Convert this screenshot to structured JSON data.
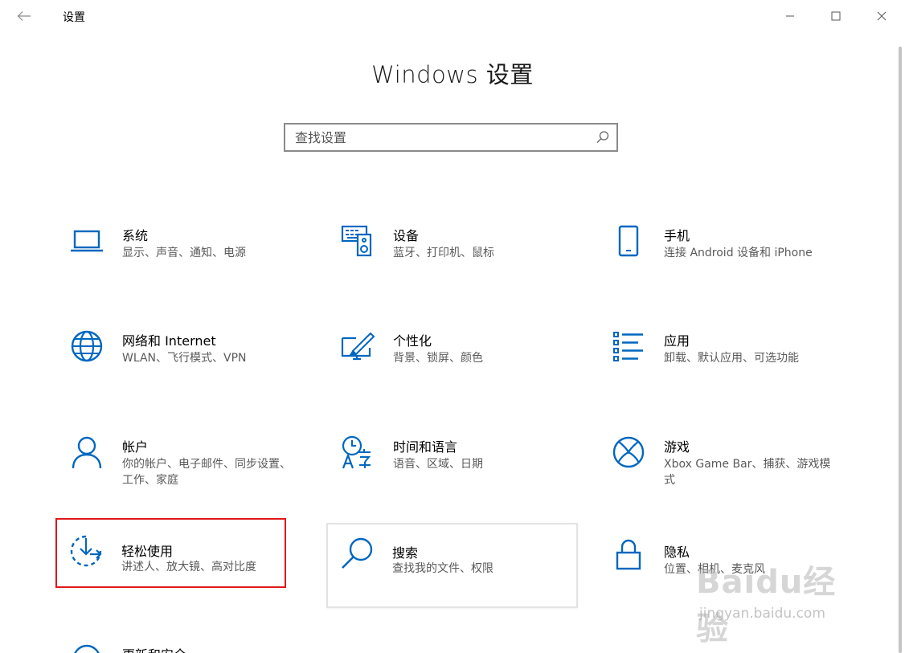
{
  "window": {
    "title": "设置"
  },
  "header": {
    "title": "Windows 设置"
  },
  "search": {
    "placeholder": "查找设置"
  },
  "tiles": [
    {
      "title": "系统",
      "desc": "显示、声音、通知、电源",
      "icon": "laptop-icon"
    },
    {
      "title": "设备",
      "desc": "蓝牙、打印机、鼠标",
      "icon": "devices-icon"
    },
    {
      "title": "手机",
      "desc": "连接 Android 设备和 iPhone",
      "icon": "phone-icon"
    },
    {
      "title": "网络和 Internet",
      "desc": "WLAN、飞行模式、VPN",
      "icon": "globe-icon"
    },
    {
      "title": "个性化",
      "desc": "背景、锁屏、颜色",
      "icon": "personalization-icon"
    },
    {
      "title": "应用",
      "desc": "卸载、默认应用、可选功能",
      "icon": "apps-list-icon"
    },
    {
      "title": "帐户",
      "desc": "你的帐户、电子邮件、同步设置、工作、家庭",
      "icon": "person-icon"
    },
    {
      "title": "时间和语言",
      "desc": "语音、区域、日期",
      "icon": "time-language-icon"
    },
    {
      "title": "游戏",
      "desc": "Xbox Game Bar、捕获、游戏模式",
      "icon": "xbox-icon"
    },
    {
      "title": "轻松使用",
      "desc": "讲述人、放大镜、高对比度",
      "icon": "ease-of-access-icon"
    },
    {
      "title": "搜索",
      "desc": "查找我的文件、权限",
      "icon": "search-magnifier-icon"
    },
    {
      "title": "隐私",
      "desc": "位置、相机、麦克风",
      "icon": "lock-icon"
    },
    {
      "title": "更新和安全",
      "desc": "",
      "icon": "update-icon"
    }
  ],
  "watermark": {
    "logo": "Baidu经验",
    "url": "jingyan.baidu.com"
  },
  "colors": {
    "accent": "#0067c0",
    "highlight": "#e01818"
  }
}
